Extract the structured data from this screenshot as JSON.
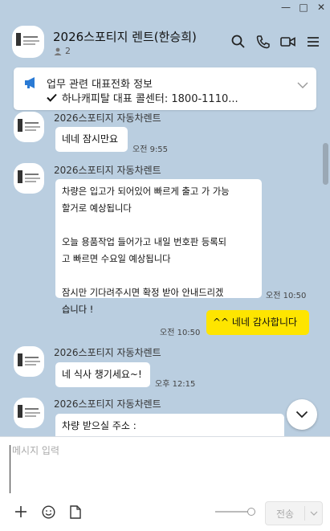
{
  "window": {
    "minimize": "—",
    "maximize": "□",
    "close": "✕"
  },
  "header": {
    "title": "2026스포티지 렌트(한승희)",
    "member_count": "2"
  },
  "notice": {
    "title": "업무 관련 대표전화 정보",
    "body": "하나캐피탈 대표 콜센터: 1800-1110..."
  },
  "messages": [
    {
      "sender": "2026스포티지 자동차렌트",
      "text": "네네 잠시만요",
      "time": "오전 9:55"
    },
    {
      "sender": "2026스포티지 자동차렌트",
      "text": "차량은 입고가 되어있어 빠르게 출고 가 가능\n할거로 예상됩니다\n\n오늘 용품작업 들어가고 내일 번호판 등록되\n고 빠르면 수요일 예상됩니다\n\n잠시만 기다려주시면 확정 받아 안내드리겠\n습니다 !",
      "time": "오전 10:50"
    },
    {
      "sender": "me",
      "text": "^^ 네네 감사합니다",
      "time": "오전 10:50"
    },
    {
      "sender": "2026스포티지 자동차렌트",
      "text": "네 식사 챙기세요~!",
      "time": "오후 12:15"
    },
    {
      "sender": "2026스포티지 자동차렌트",
      "text": "차량 받으실 주소 :",
      "time": ""
    }
  ],
  "composer": {
    "placeholder": "메시지 입력",
    "send_label": "전송"
  },
  "colors": {
    "background": "#bacee0",
    "my_bubble": "#fee500",
    "other_bubble": "#ffffff"
  }
}
